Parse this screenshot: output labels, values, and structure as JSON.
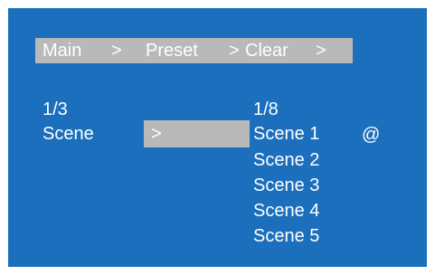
{
  "breadcrumb": {
    "items": [
      "Main",
      ">",
      "Preset",
      ">",
      "Clear",
      ">"
    ]
  },
  "left_panel": {
    "page": "1/3",
    "label": "Scene",
    "arrow": ">"
  },
  "right_panel": {
    "page": "1/8",
    "items": [
      "Scene 1",
      "Scene 2",
      "Scene 3",
      "Scene 4",
      "Scene 5"
    ],
    "marker": "@"
  },
  "colors": {
    "background": "#1b6fbd",
    "highlight": "#b9b9b9",
    "text": "#ffffff"
  }
}
